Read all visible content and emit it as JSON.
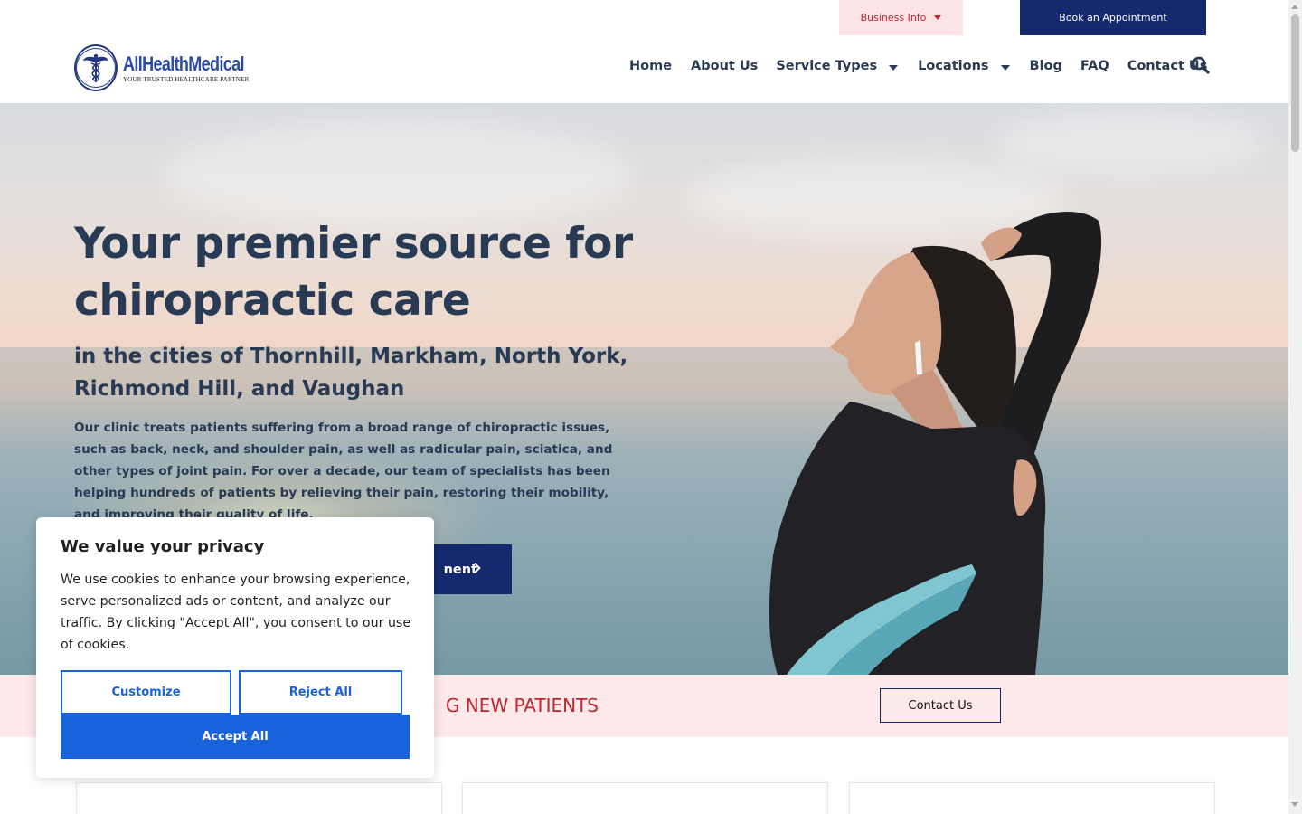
{
  "topbar": {
    "business_info": "Business Info",
    "book_appointment": "Book an Appointment"
  },
  "logo": {
    "name": "AllHealthMedical",
    "tagline": "YOUR TRUSTED HEALTHCARE PARTNER"
  },
  "nav": {
    "items": [
      {
        "label": "Home",
        "dropdown": false
      },
      {
        "label": "About Us",
        "dropdown": false
      },
      {
        "label": "Service Types",
        "dropdown": true
      },
      {
        "label": "Locations",
        "dropdown": true
      },
      {
        "label": "Blog",
        "dropdown": false
      },
      {
        "label": "FAQ",
        "dropdown": false
      },
      {
        "label": "Contact Us",
        "dropdown": false
      }
    ],
    "search_icon": "search-icon"
  },
  "hero": {
    "title": "Your premier source for chiropractic care",
    "subtitle": "in the cities of Thornhill, Markham, North York, Richmond Hill, and Vaughan",
    "body": "Our clinic treats patients suffering from a broad range of chiropractic issues, such as back, neck, and shoulder pain, as well as radicular pain, sciatica, and other types of joint pain. For over a decade, our team of specialists has been helping hundreds of patients by relieving their pain, restoring their mobility, and improving their quality of life.",
    "cta_label": "nent"
  },
  "banner": {
    "text": "G NEW PATIENTS",
    "contact_label": "Contact Us"
  },
  "cookie": {
    "title": "We value your privacy",
    "text": "We use cookies to enhance your browsing experience, serve personalized ads or content, and analyze our traffic. By clicking \"Accept All\", you consent to our use of cookies.",
    "customize": "Customize",
    "reject": "Reject All",
    "accept": "Accept All"
  },
  "colors": {
    "navy": "#14296e",
    "nav_text": "#2a3a52",
    "red": "#c0262d",
    "pink_bg": "#fde8ea",
    "cookie_blue": "#1863dc"
  }
}
